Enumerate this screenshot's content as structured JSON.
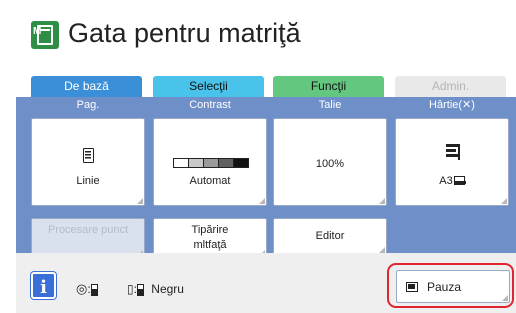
{
  "title": {
    "text": "Gata pentru matriţă",
    "icon": "master-ready-icon"
  },
  "tabs": [
    {
      "label": "De bază",
      "active": true
    },
    {
      "label": "Selecţii"
    },
    {
      "label": "Funcţii"
    },
    {
      "label": "Admin.",
      "disabled": true
    }
  ],
  "columns": [
    {
      "header": "Pag.",
      "value": "Linie",
      "icon": "page-text-icon"
    },
    {
      "header": "Contrast",
      "value": "Automat",
      "icon": "contrast-scale-icon"
    },
    {
      "header": "Talie",
      "value": "100%"
    },
    {
      "header": "Hârtie(✕)",
      "value": "A3",
      "icon": "paper-feed-icon"
    }
  ],
  "bottom_buttons": [
    {
      "label": "Procesare punct",
      "disabled": true
    },
    {
      "label": "Tipărire mltfaţă"
    },
    {
      "label": "Editor"
    }
  ],
  "status": {
    "drum_label": ":",
    "ink_label": ":",
    "ink_color": "Negru"
  },
  "pause_button": {
    "label": "Pauza"
  },
  "colors": {
    "title_icon": "#2e8e46",
    "tab_basic": "#3a8fd8",
    "tab_selections": "#49c3ea",
    "tab_functions": "#63c77f",
    "main_area": "#6f8fc9",
    "pause_highlight": "#e0262e"
  }
}
